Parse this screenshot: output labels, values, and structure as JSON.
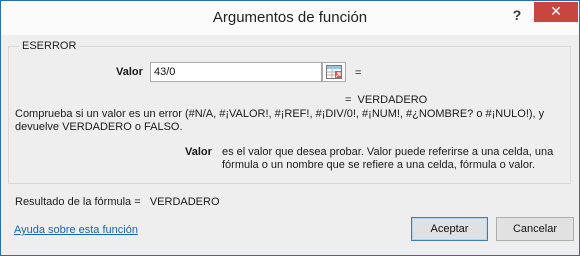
{
  "window": {
    "title": "Argumentos de función",
    "help_glyph": "?",
    "close_glyph": "✕"
  },
  "function": {
    "name": "ESERROR",
    "argument": {
      "label": "Valor",
      "value": "43/0",
      "equals": "=",
      "result_line": "=  VERDADERO"
    },
    "description": "Comprueba si un valor es un error (#N/A, #¡VALOR!, #¡REF!, #¡DIV/0!, #¡NUM!, #¿NOMBRE? o #¡NULO!), y devuelve VERDADERO o FALSO.",
    "param_help": {
      "label": "Valor",
      "text": "es el valor que desea probar. Valor puede referirse a una celda, una fórmula o un nombre que se refiere a una celda, fórmula o valor."
    }
  },
  "formula_result": "Resultado de la fórmula =   VERDADERO",
  "help_link": "Ayuda sobre esta función",
  "buttons": {
    "ok": "Aceptar",
    "cancel": "Cancelar"
  },
  "colors": {
    "accent_border": "#2b6db3",
    "close_red": "#c7463f",
    "link_blue": "#1b63b4"
  }
}
